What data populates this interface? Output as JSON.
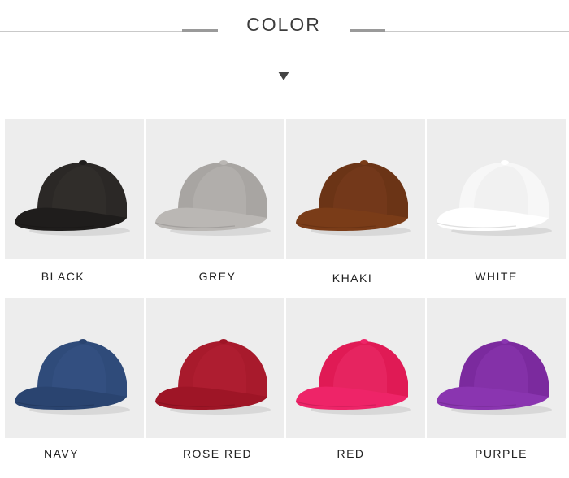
{
  "header": {
    "title": "COLOR"
  },
  "colors": [
    {
      "label": "BLACK",
      "crown": "#2b2826",
      "brim": "#1f1d1c",
      "shade": "#3a3633"
    },
    {
      "label": "GREY",
      "crown": "#a8a5a2",
      "brim": "#bab7b4",
      "shade": "#c2bfbc"
    },
    {
      "label": "KHAKI",
      "crown": "#6b3416",
      "brim": "#7a3c18",
      "shade": "#854322"
    },
    {
      "label": "WHITE",
      "crown": "#f7f7f7",
      "brim": "#ffffff",
      "shade": "#e6e6e6"
    },
    {
      "label": "NAVY",
      "crown": "#2f4b7a",
      "brim": "#2a4470",
      "shade": "#3b5a8c"
    },
    {
      "label": "ROSE RED",
      "crown": "#a81a2c",
      "brim": "#9e1526",
      "shade": "#b92638"
    },
    {
      "label": "RED",
      "crown": "#e01a55",
      "brim": "#ee2468",
      "shade": "#f03a75"
    },
    {
      "label": "PURPLE",
      "crown": "#7b2a9e",
      "brim": "#8a35b0",
      "shade": "#9440ba"
    }
  ]
}
